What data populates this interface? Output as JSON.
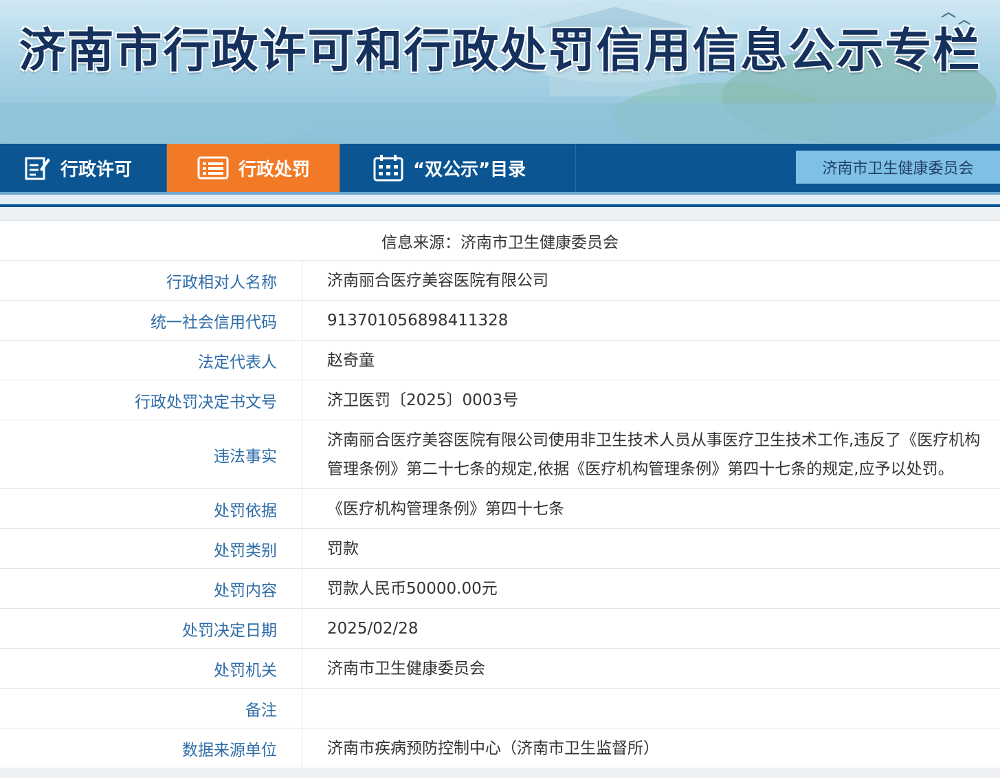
{
  "banner": {
    "title": "济南市行政许可和行政处罚信用信息公示专栏"
  },
  "nav": {
    "items": [
      {
        "label": "行政许可",
        "icon": "edit-icon"
      },
      {
        "label": "行政处罚",
        "icon": "list-icon"
      },
      {
        "label": "“双公示”目录",
        "icon": "calendar-icon"
      }
    ],
    "right_label": "济南市卫生健康委员会",
    "colors": {
      "bar": "#0b5592",
      "active": "#f27a26",
      "right": "#7fc0e6"
    }
  },
  "info": {
    "source": "信息来源：济南市卫生健康委员会",
    "rows": [
      {
        "label": "行政相对人名称",
        "value": "济南丽合医疗美容医院有限公司"
      },
      {
        "label": "统一社会信用代码",
        "value": "913701056898411328"
      },
      {
        "label": "法定代表人",
        "value": "赵奇童"
      },
      {
        "label": "行政处罚决定书文号",
        "value": "济卫医罚〔2025〕0003号"
      },
      {
        "label": "违法事实",
        "value": "济南丽合医疗美容医院有限公司使用非卫生技术人员从事医疗卫生技术工作,违反了《医疗机构管理条例》第二十七条的规定,依据《医疗机构管理条例》第四十七条的规定,应予以处罚。"
      },
      {
        "label": "处罚依据",
        "value": "《医疗机构管理条例》第四十七条"
      },
      {
        "label": "处罚类别",
        "value": "罚款"
      },
      {
        "label": "处罚内容",
        "value": "罚款人民币50000.00元"
      },
      {
        "label": "处罚决定日期",
        "value": "2025/02/28"
      },
      {
        "label": "处罚机关",
        "value": "济南市卫生健康委员会"
      },
      {
        "label": "备注",
        "value": ""
      },
      {
        "label": "数据来源单位",
        "value": "济南市疾病预防控制中心（济南市卫生监督所）"
      }
    ]
  }
}
